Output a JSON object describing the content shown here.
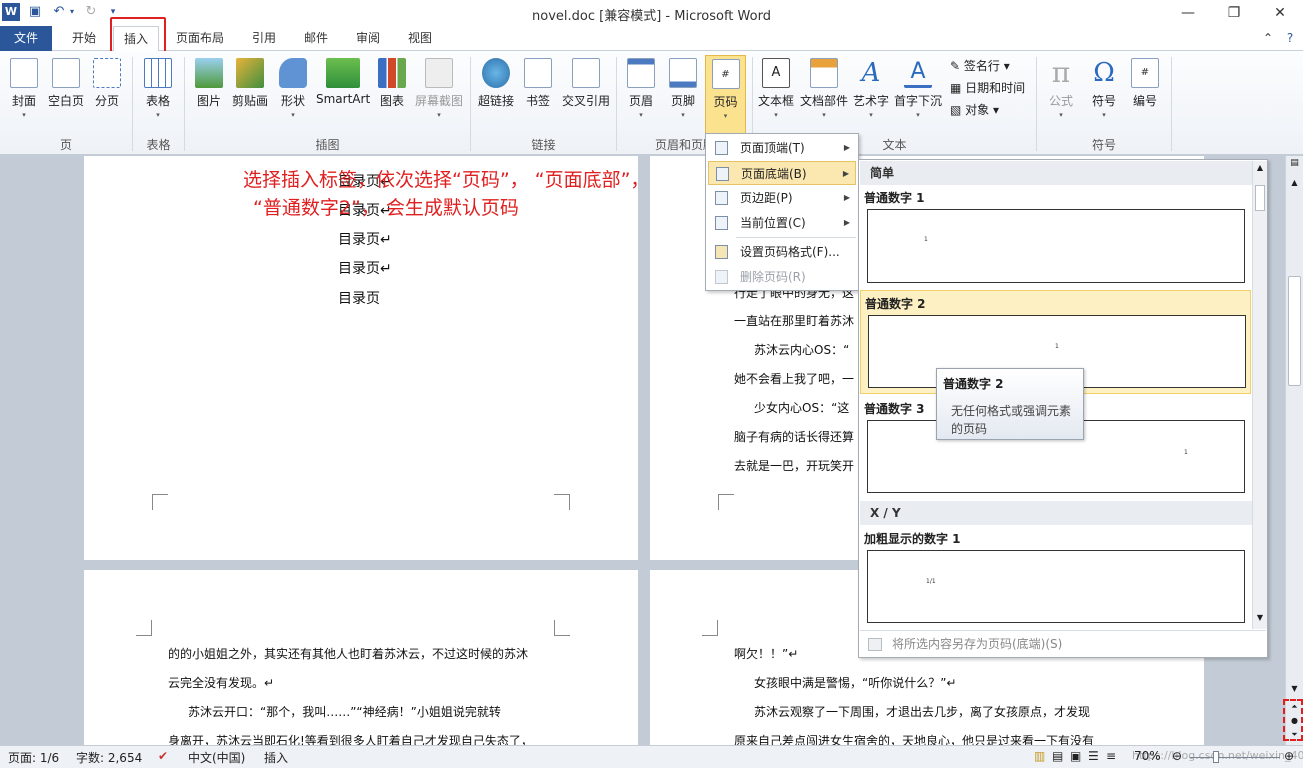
{
  "titlebar": {
    "title": "novel.doc [兼容模式] - Microsoft Word",
    "min": "—",
    "max": "❐",
    "close": "✕"
  },
  "tabs": [
    "文件",
    "开始",
    "插入",
    "页面布局",
    "引用",
    "邮件",
    "审阅",
    "视图"
  ],
  "ribbon": {
    "page": {
      "cover": "封面",
      "blank": "空白页",
      "break": "分页",
      "group": "页"
    },
    "table": {
      "table": "表格",
      "group": "表格"
    },
    "illustrations": {
      "picture": "图片",
      "clipart": "剪贴画",
      "shapes": "形状",
      "smartart": "SmartArt",
      "chart": "图表",
      "screenshot": "屏幕截图",
      "group": "插图"
    },
    "links": {
      "hyperlink": "超链接",
      "bookmark": "书签",
      "crossref": "交叉引用",
      "group": "链接"
    },
    "header_footer": {
      "header": "页眉",
      "footer": "页脚",
      "pagenum": "页码",
      "group": "页眉和页脚"
    },
    "text": {
      "textbox": "文本框",
      "quickparts": "文档部件",
      "wordart": "艺术字",
      "dropcap": "首字下沉",
      "signature": "签名行",
      "datetime": "日期和时间",
      "object": "对象",
      "group": "文本"
    },
    "symbols": {
      "equation": "公式",
      "symbol": "符号",
      "number": "编号",
      "group": "符号"
    }
  },
  "menu": [
    "页面顶端(T)",
    "页面底端(B)",
    "页边距(P)",
    "当前位置(C)",
    "设置页码格式(F)...",
    "删除页码(R)"
  ],
  "gallery": {
    "section1": "简单",
    "items": [
      {
        "title": "普通数字 1",
        "num": "1"
      },
      {
        "title": "普通数字 2",
        "num": "1"
      },
      {
        "title": "普通数字 3",
        "num": "1"
      }
    ],
    "section2": "X / Y",
    "item4": {
      "title": "加粗显示的数字 1",
      "num": "1/1"
    },
    "footer": "将所选内容另存为页码(底端)(S)"
  },
  "tooltip": {
    "title": "普通数字 2",
    "body1": "无任何格式或强调元素",
    "body2": "的页码"
  },
  "annotation": {
    "line1": "选择插入标签，依次选择“页码”， “页面底部”，",
    "line2": "“普通数字2”， 会生成默认页码"
  },
  "doc": {
    "toc": [
      "目录页↵",
      "目录页↵",
      "目录页↵",
      "目录页↵",
      "目录页"
    ],
    "right_top": [
      "行走了眼中的身无，这",
      "一直站在那里盯着苏沐",
      "苏沐云内心OS：“",
      "她不会看上我了吧，一",
      "少女内心OS：“这",
      "脑子有病的话长得还算",
      "去就是一巴，开玩笑开"
    ],
    "left_bottom": [
      "的的小姐姐之外，其实还有其他人也盯着苏沐云，不过这时候的苏沐",
      "云完全没有发现。↵",
      "苏沐云开口：“那个，我叫……”“神经病！”小姐姐说完就转",
      "身离开，苏沐云当即石化!等看到很多人盯着自己才发现自己失态了，"
    ],
    "right_bottom": [
      "啊欠！！”↵",
      "女孩眼中满是警惕，“听你说什么？”↵",
      "苏沐云观察了一下周围，才退出去几步，离了女孩原点，才发现",
      "原来自己差点闯进女生宿舍的，天地良心，他只是过来看一下有没有"
    ]
  },
  "status": {
    "page": "页面: 1/6",
    "words": "字数: 2,654",
    "lang": "中文(中国)",
    "mode": "插入",
    "zoom": "70%",
    "watermark": "https://blog.csdn.net/weixin_40050369"
  }
}
